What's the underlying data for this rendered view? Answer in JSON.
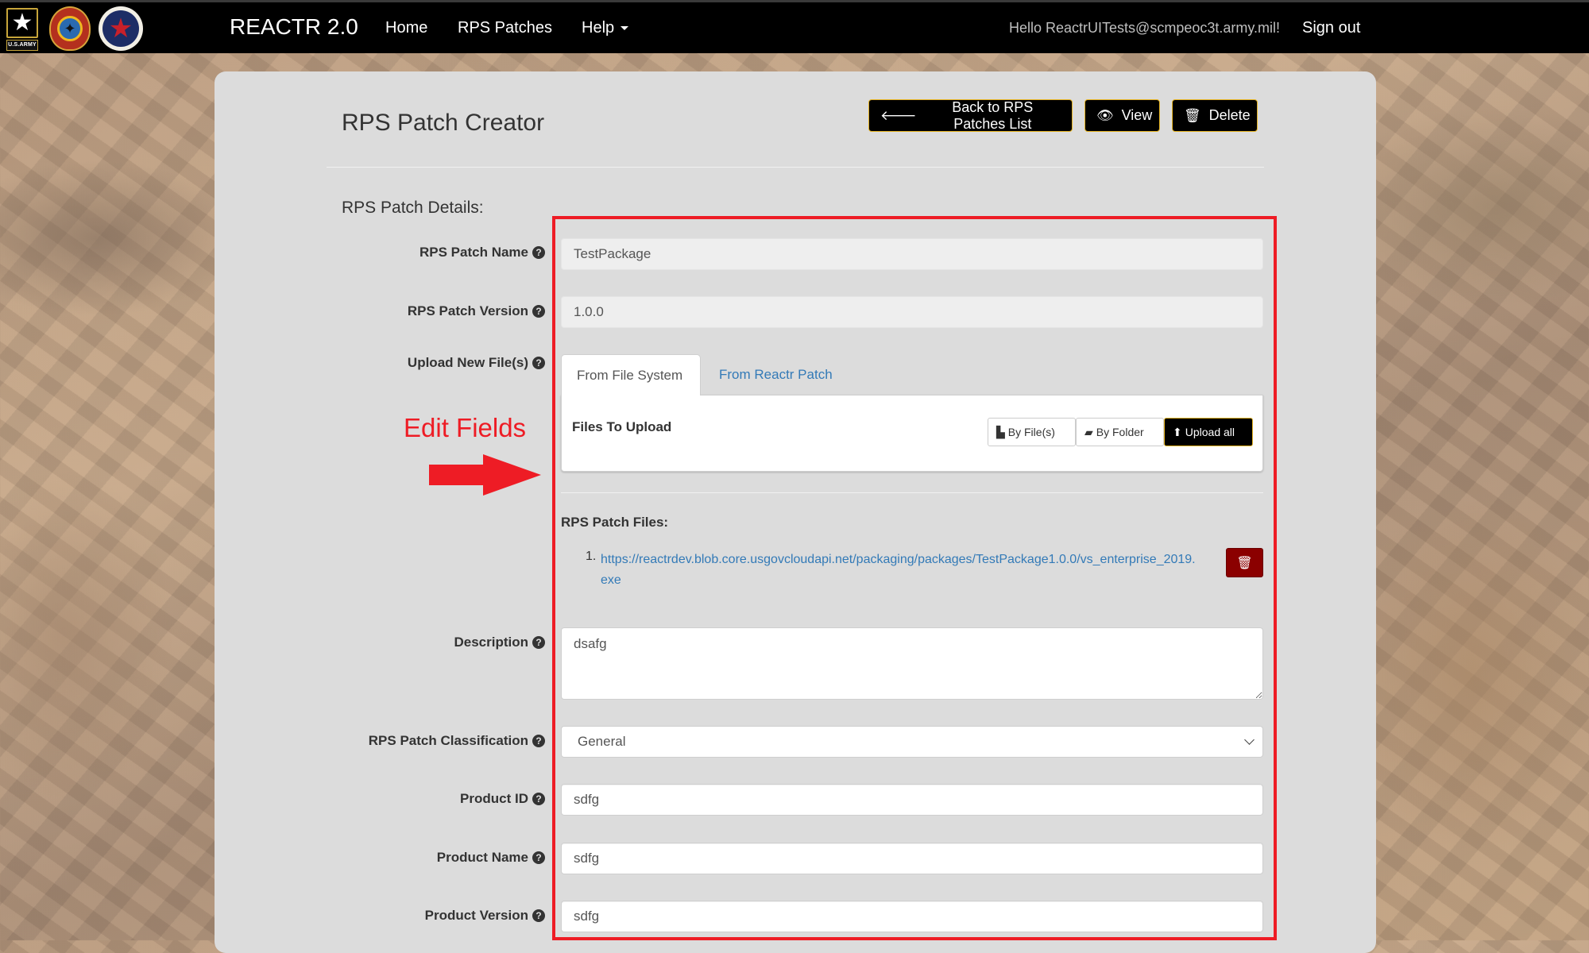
{
  "navbar": {
    "logos": [
      "us-army-logo",
      "signal-corps-crest-logo",
      "command-seal-logo"
    ],
    "army_tag": "U.S.ARMY",
    "brand": "REACTR 2.0",
    "links": [
      {
        "label": "Home"
      },
      {
        "label": "RPS Patches"
      },
      {
        "label": "Help",
        "has_dropdown": true
      }
    ],
    "greeting": "Hello ReactrUITests@scmpeoc3t.army.mil!",
    "signout": "Sign out"
  },
  "page": {
    "title": "RPS Patch Creator",
    "buttons": {
      "back": {
        "label": "Back to RPS Patches List",
        "icon": "arrow-left-icon"
      },
      "view": {
        "label": "View",
        "icon": "eye-icon"
      },
      "delete": {
        "label": "Delete",
        "icon": "trash-icon"
      }
    },
    "section_title": "RPS Patch Details:"
  },
  "form": {
    "patch_name": {
      "label": "RPS Patch Name",
      "value": "TestPackage"
    },
    "patch_version": {
      "label": "RPS Patch Version",
      "value": "1.0.0"
    },
    "upload": {
      "label": "Upload New File(s)",
      "tabs": [
        {
          "label": "From File System",
          "active": true
        },
        {
          "label": "From Reactr Patch",
          "active": false
        }
      ],
      "files_to_upload": "Files To Upload",
      "by_files": "By File(s)",
      "by_folder": "By Folder",
      "upload_all": "Upload all"
    },
    "patch_files": {
      "title": "RPS Patch Files:",
      "items": [
        {
          "number": "1.",
          "url": "https://reactrdev.blob.core.usgovcloudapi.net/packaging/packages/TestPackage1.0.0/vs_enterprise_2019.exe"
        }
      ]
    },
    "description": {
      "label": "Description",
      "value": "dsafg"
    },
    "classification": {
      "label": "RPS Patch Classification",
      "value": "General"
    },
    "product_id": {
      "label": "Product ID",
      "value": "sdfg"
    },
    "product_name": {
      "label": "Product Name",
      "value": "sdfg"
    },
    "product_version": {
      "label": "Product Version",
      "value": "sdfg"
    }
  },
  "annotation": {
    "text": "Edit Fields",
    "color": "#ee1c25"
  },
  "colors": {
    "navbar_bg": "#000000",
    "button_border": "#e6b422",
    "link": "#337ab7",
    "danger": "#8b0000",
    "panel_bg": "#dcdcdc"
  }
}
